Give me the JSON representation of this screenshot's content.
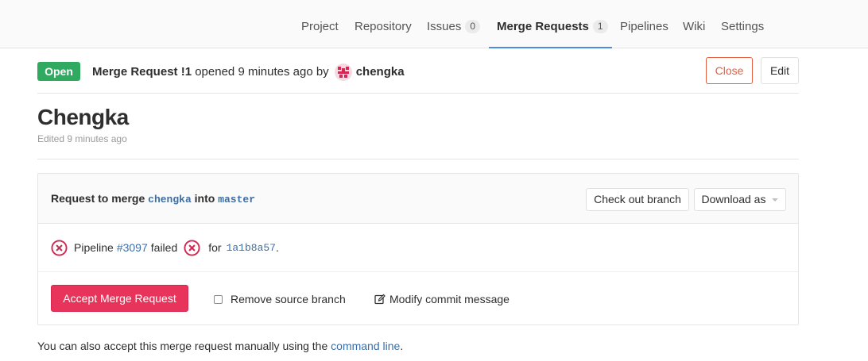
{
  "nav": {
    "tabs": [
      {
        "label": "Project"
      },
      {
        "label": "Repository"
      },
      {
        "label": "Issues",
        "count": "0"
      },
      {
        "label": "Merge Requests",
        "count": "1",
        "active": true
      },
      {
        "label": "Pipelines"
      },
      {
        "label": "Wiki"
      },
      {
        "label": "Settings"
      }
    ]
  },
  "header": {
    "status": "Open",
    "mr_ref": "Merge Request !1",
    "opened_text": "opened 9 minutes ago by",
    "author": "chengka",
    "close_label": "Close",
    "edit_label": "Edit"
  },
  "title": "Chengka",
  "edited": "Edited 9 minutes ago",
  "merge_panel": {
    "request_prefix": "Request to merge",
    "source_branch": "chengka",
    "into": "into",
    "target_branch": "master",
    "checkout_label": "Check out branch",
    "download_label": "Download as",
    "pipeline_label": "Pipeline",
    "pipeline_id": "#3097",
    "pipeline_status": "failed",
    "for_text": "for",
    "commit_sha": "1a1b8a57",
    "accept_label": "Accept Merge Request",
    "remove_source_label": "Remove source branch",
    "modify_commit_label": "Modify commit message"
  },
  "footer": {
    "text": "You can also accept this merge request manually using the",
    "link": "command line",
    "end": "."
  },
  "colors": {
    "open": "#2faa60",
    "close": "#e75e40",
    "accept": "#e8335a",
    "failed": "#d22852",
    "link": "#3b6ea8",
    "active_tab": "#4a8bee"
  }
}
